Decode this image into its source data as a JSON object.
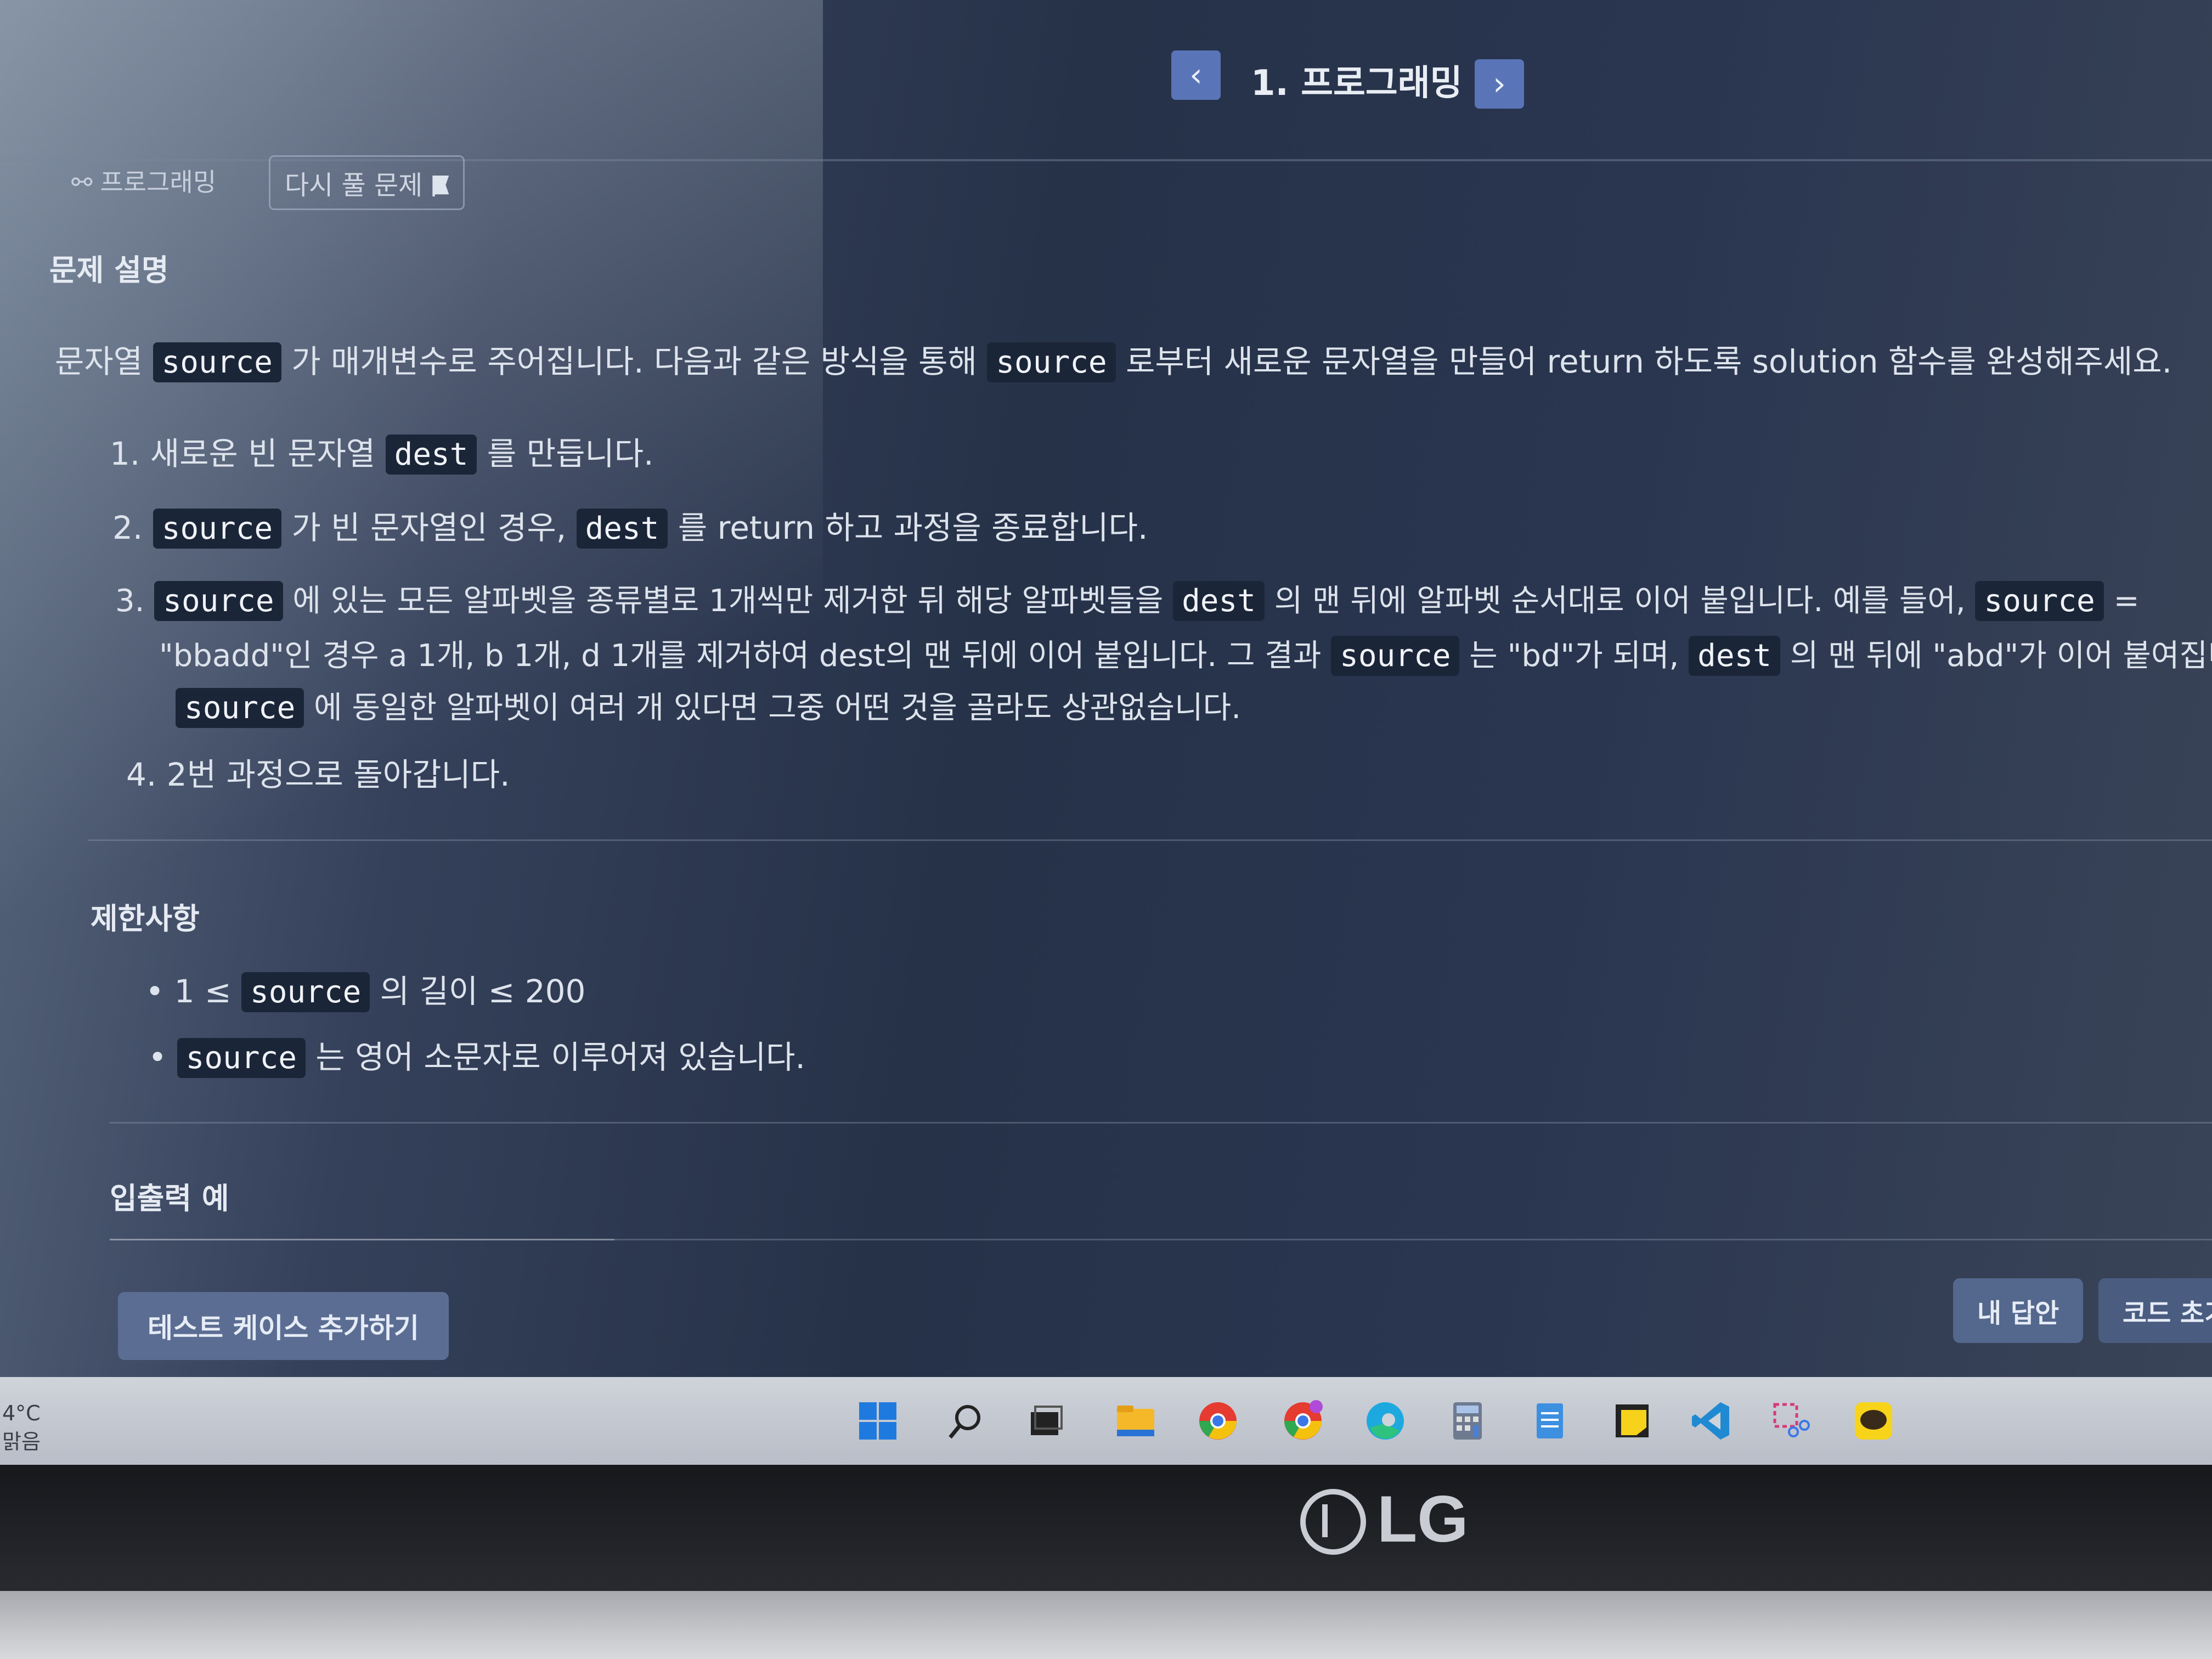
{
  "header": {
    "prev_icon": "chevron-left-icon",
    "next_icon": "chevron-right-icon",
    "prev_glyph": "‹",
    "next_glyph": "›",
    "title": "1. 프로그래밍"
  },
  "breadcrumb": {
    "category": "프로그래밍",
    "category_icon": "nodes-icon",
    "retry_label": "다시 풀 문제",
    "retry_icon": "flag-icon"
  },
  "description": {
    "title": "문제 설명",
    "intro_a": "문자열",
    "intro_code1": "source",
    "intro_b": "가 매개변수로 주어집니다. 다음과 같은 방식을 통해",
    "intro_code2": "source",
    "intro_c": "로부터 새로운 문자열을 만들어 return 하도록 solution 함수를 완성해주세요.",
    "step1_a": "1. 새로운 빈 문자열",
    "step1_code": "dest",
    "step1_b": "를 만듭니다.",
    "step2_a": "2.",
    "step2_code1": "source",
    "step2_b": "가 빈 문자열인 경우,",
    "step2_code2": "dest",
    "step2_c": "를 return 하고 과정을 종료합니다.",
    "step3_a": "3.",
    "step3_code1": "source",
    "step3_b": "에 있는 모든 알파벳을 종류별로 1개씩만 제거한 뒤 해당 알파벳들을",
    "step3_code2": "dest",
    "step3_c": "의 맨 뒤에 알파벳 순서대로 이어 붙입니다. 예를 들어,",
    "step3_code3": "source",
    "step3_d": "=",
    "step3_line2_a": "\"bbadd\"인 경우 a 1개, b 1개, d 1개를 제거하여 dest의 맨 뒤에 이어 붙입니다. 그 결과",
    "step3_line2_code1": "source",
    "step3_line2_b": "는 \"bd\"가 되며,",
    "step3_line2_code2": "dest",
    "step3_line2_c": "의 맨 뒤에 \"abd\"가 이어 붙여집니",
    "step3_line3_code": "source",
    "step3_line3_b": "에 동일한 알파벳이 여러 개 있다면 그중 어떤 것을 골라도 상관없습니다.",
    "step4": "4. 2번 과정으로 돌아갑니다."
  },
  "limits": {
    "title": "제한사항",
    "item1_a": "1 ≤",
    "item1_code": "source",
    "item1_b": "의 길이 ≤ 200",
    "item2_code": "source",
    "item2_b": "는 영어 소문자로 이루어져 있습니다."
  },
  "io": {
    "title": "입출력 예"
  },
  "footer": {
    "add_test": "테스트 케이스 추가하기",
    "my_answer": "내 답안",
    "reset_code": "코드 초기"
  },
  "taskbar": {
    "weather_temp": "4°C",
    "weather_desc": "맑음",
    "icons": [
      "windows-start-icon",
      "search-icon",
      "task-view-icon",
      "file-explorer-icon",
      "chrome-icon",
      "chrome-profile-icon",
      "edge-icon",
      "calculator-icon",
      "notepad-icon",
      "sticky-notes-icon",
      "vscode-icon",
      "snipping-tool-icon",
      "kakaotalk-icon"
    ]
  },
  "bezel": {
    "brand": "LG"
  },
  "colors": {
    "accent": "#5a74b8",
    "code_bg": "#1b2538",
    "button_bg": "#5b6d92"
  }
}
